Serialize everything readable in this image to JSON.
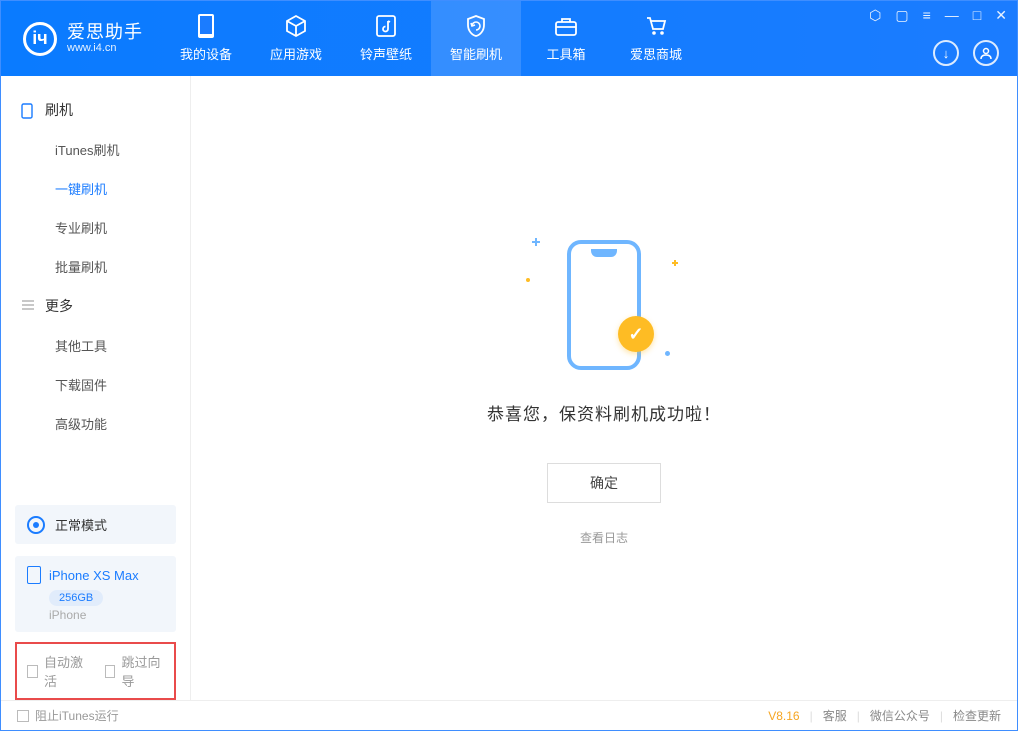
{
  "app": {
    "name_cn": "爱思助手",
    "name_en": "www.i4.cn"
  },
  "nav": {
    "tabs": [
      {
        "label": "我的设备"
      },
      {
        "label": "应用游戏"
      },
      {
        "label": "铃声壁纸"
      },
      {
        "label": "智能刷机"
      },
      {
        "label": "工具箱"
      },
      {
        "label": "爱思商城"
      }
    ],
    "active_index": 3
  },
  "sidebar": {
    "groups": [
      {
        "title": "刷机",
        "items": [
          "iTunes刷机",
          "一键刷机",
          "专业刷机",
          "批量刷机"
        ],
        "active_index": 1
      },
      {
        "title": "更多",
        "items": [
          "其他工具",
          "下载固件",
          "高级功能"
        ],
        "active_index": -1
      }
    ],
    "mode_label": "正常模式",
    "device": {
      "name": "iPhone XS Max",
      "capacity": "256GB",
      "type": "iPhone"
    },
    "options": {
      "auto_activate": "自动激活",
      "skip_guide": "跳过向导"
    }
  },
  "main": {
    "success_text": "恭喜您，保资料刷机成功啦！",
    "ok_button": "确定",
    "view_log": "查看日志"
  },
  "footer": {
    "block_itunes": "阻止iTunes运行",
    "version": "V8.16",
    "links": [
      "客服",
      "微信公众号",
      "检查更新"
    ]
  }
}
